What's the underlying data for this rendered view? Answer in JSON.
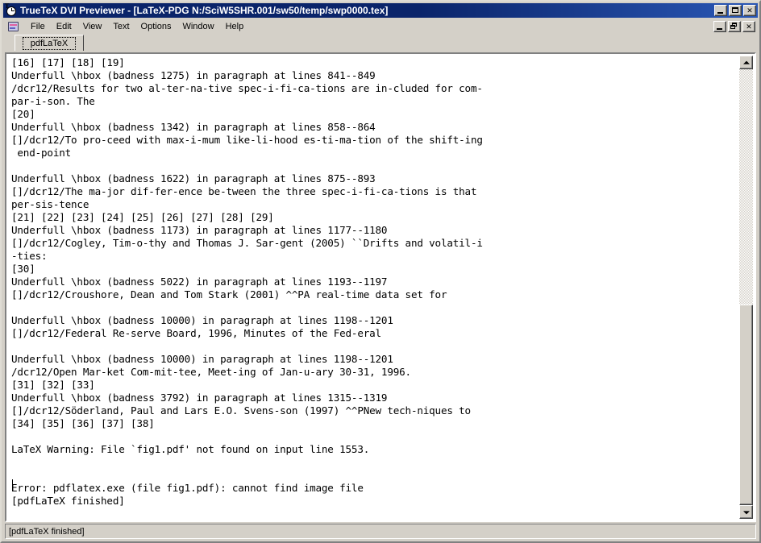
{
  "window": {
    "title": "TrueTeX DVI Previewer - [LaTeX-PDG N:/SciW5SHR.001/sw50/temp/swp0000.tex]",
    "icon": "tex-clock-icon",
    "controls": {
      "minimize": "_",
      "maximize": "□",
      "close": "✕"
    }
  },
  "menu": {
    "icon": "document-icon",
    "items": [
      {
        "label": "File"
      },
      {
        "label": "Edit"
      },
      {
        "label": "View"
      },
      {
        "label": "Text"
      },
      {
        "label": "Options"
      },
      {
        "label": "Window"
      },
      {
        "label": "Help"
      }
    ],
    "child_controls": {
      "minimize": "_",
      "restore": "❐",
      "close": "✕"
    }
  },
  "tabs": [
    {
      "label": "pdfLaTeX",
      "selected": true
    }
  ],
  "log": {
    "content": "[16] [17] [18] [19]\nUnderfull \\hbox (badness 1275) in paragraph at lines 841--849\n/dcr12/Results for two al-ter-na-tive spec-i-fi-ca-tions are in-cluded for com-\npar-i-son. The\n[20]\nUnderfull \\hbox (badness 1342) in paragraph at lines 858--864\n[]/dcr12/To pro-ceed with max-i-mum like-li-hood es-ti-ma-tion of the shift-ing\n end-point\n\nUnderfull \\hbox (badness 1622) in paragraph at lines 875--893\n[]/dcr12/The ma-jor dif-fer-ence be-tween the three spec-i-fi-ca-tions is that\nper-sis-tence\n[21] [22] [23] [24] [25] [26] [27] [28] [29]\nUnderfull \\hbox (badness 1173) in paragraph at lines 1177--1180\n[]/dcr12/Cogley, Tim-o-thy and Thomas J. Sar-gent (2005) ``Drifts and volatil-i\n-ties:\n[30]\nUnderfull \\hbox (badness 5022) in paragraph at lines 1193--1197\n[]/dcr12/Croushore, Dean and Tom Stark (2001) ^^PA real-time data set for\n\nUnderfull \\hbox (badness 10000) in paragraph at lines 1198--1201\n[]/dcr12/Federal Re-serve Board, 1996, Minutes of the Fed-eral\n\nUnderfull \\hbox (badness 10000) in paragraph at lines 1198--1201\n/dcr12/Open Mar-ket Com-mit-tee, Meet-ing of Jan-u-ary 30-31, 1996.\n[31] [32] [33]\nUnderfull \\hbox (badness 3792) in paragraph at lines 1315--1319\n[]/dcr12/Söderland, Paul and Lars E.O. Svens-son (1997) ^^PNew tech-niques to\n[34] [35] [36] [37] [38]\n\nLaTeX Warning: File `fig1.pdf' not found on input line 1553.\n\n\nError: pdflatex.exe (file fig1.pdf): cannot find image file\n[pdfLaTeX finished]"
  },
  "scrollbar": {
    "up_arrow": "scroll-up-arrow-icon",
    "down_arrow": "scroll-down-arrow-icon"
  },
  "status": {
    "text": "[pdfLaTeX finished]"
  },
  "colors": {
    "titlebar_start": "#0a246a",
    "titlebar_end": "#2a57b5",
    "chrome": "#d4d0c8",
    "text": "#000000",
    "pane_bg": "#ffffff"
  }
}
